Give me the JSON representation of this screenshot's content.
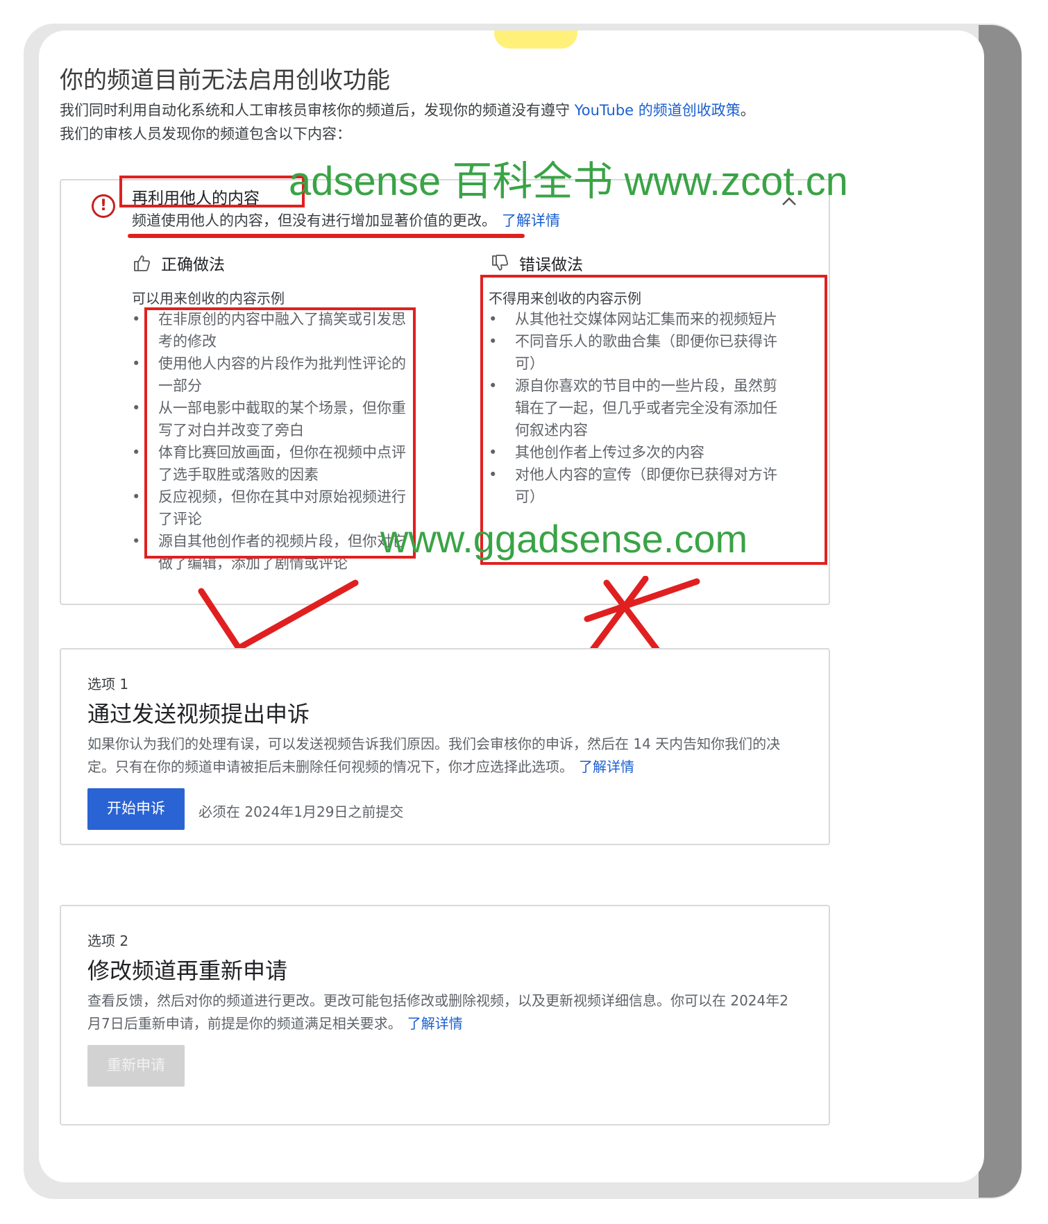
{
  "page": {
    "title": "你的频道目前无法启用创收功能",
    "intro_line1": "我们同时利用自动化系统和人工审核员审核你的频道后，发现你的频道没有遵守 ",
    "intro_link": "YouTube 的频道创收政策",
    "intro_line1_end": "。",
    "intro_line2": "我们的审核人员发现你的频道包含以下内容："
  },
  "issue": {
    "title": "再利用他人的内容",
    "description": "频道使用他人的内容，但没有进行增加显著价值的更改。",
    "learn_more": "了解详情",
    "alert_icon": "!",
    "collapse_icon": "chevron-up-icon"
  },
  "do": {
    "heading": "正确做法",
    "subheading": "可以用来创收的内容示例",
    "items": [
      "在非原创的内容中融入了搞笑或引发思考的修改",
      "使用他人内容的片段作为批判性评论的一部分",
      "从一部电影中截取的某个场景，但你重写了对白并改变了旁白",
      "体育比赛回放画面，但你在视频中点评了选手取胜或落败的因素",
      "反应视频，但你在其中对原始视频进行了评论",
      "源自其他创作者的视频片段，但你对它做了编辑，添加了剧情或评论"
    ]
  },
  "dont": {
    "heading": "错误做法",
    "subheading": "不得用来创收的内容示例",
    "items": [
      "从其他社交媒体网站汇集而来的视频短片",
      "不同音乐人的歌曲合集（即便你已获得许可）",
      "源自你喜欢的节目中的一些片段，虽然剪辑在了一起，但几乎或者完全没有添加任何叙述内容",
      "其他创作者上传过多次的内容",
      "对他人内容的宣传（即便你已获得对方许可）"
    ]
  },
  "watermarks": {
    "top": "adsense 百科全书 www.zcot.cn",
    "bottom": "www.ggadsense.com"
  },
  "option1": {
    "label": "选项 1",
    "title": "通过发送视频提出申诉",
    "description": "如果你认为我们的处理有误，可以发送视频告诉我们原因。我们会审核你的申诉，然后在 14 天内告知你我们的决定。只有在你的频道申请被拒后未删除任何视频的情况下，你才应选择此选项。",
    "learn_more": "了解详情",
    "button": "开始申诉",
    "deadline": "必须在 2024年1月29日之前提交"
  },
  "option2": {
    "label": "选项 2",
    "title": "修改频道再重新申请",
    "description": "查看反馈，然后对你的频道进行更改。更改可能包括修改或删除视频，以及更新视频详细信息。你可以在 2024年2月7日后重新申请，前提是你的频道满足相关要求。",
    "learn_more": "了解详情",
    "button": "重新申请"
  },
  "colors": {
    "annotation_red": "#e02020",
    "watermark_green": "#3aa346",
    "link_blue": "#1a5fd0",
    "primary_button": "#2a63d4"
  }
}
